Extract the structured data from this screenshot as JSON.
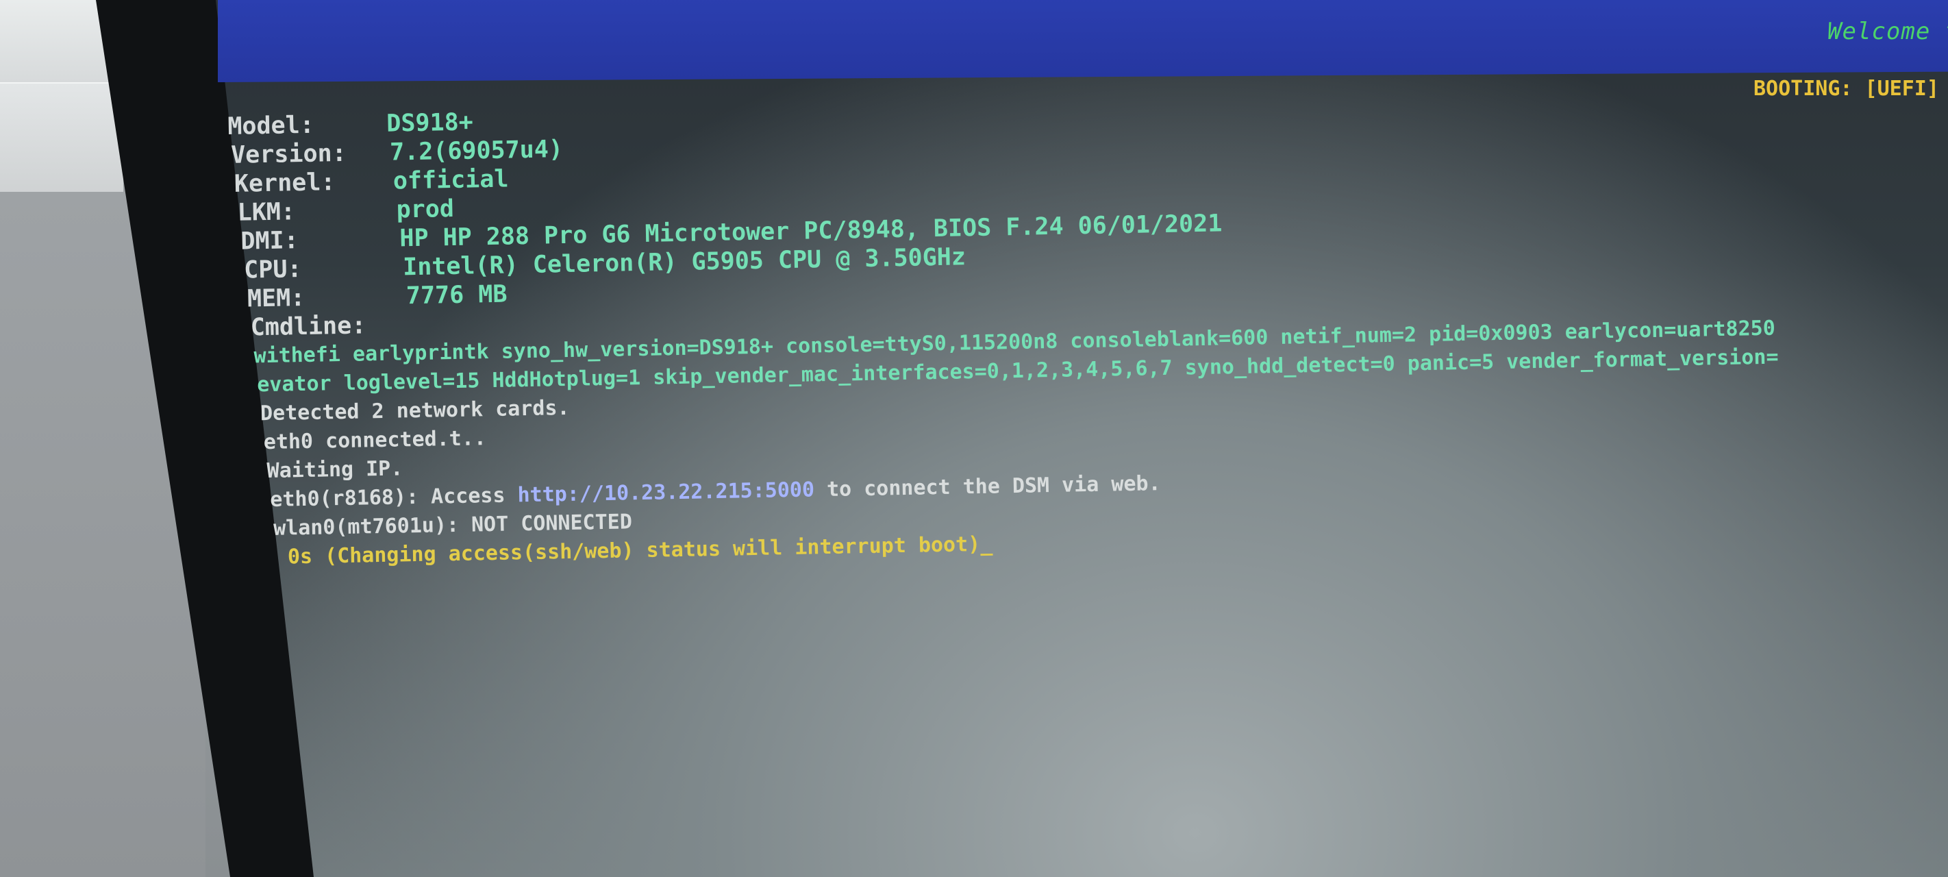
{
  "header": {
    "welcome": "Welcome t",
    "booting": "BOOTING: [UEFI]"
  },
  "system_info": [
    {
      "label": "Model:",
      "value": "DS918+"
    },
    {
      "label": "Version:",
      "value": "7.2(69057u4)"
    },
    {
      "label": "Kernel:",
      "value": "official"
    },
    {
      "label": "LKM:",
      "value": "prod"
    },
    {
      "label": "DMI:",
      "value": "HP HP 288 Pro G6 Microtower PC/8948, BIOS F.24 06/01/2021"
    },
    {
      "label": "CPU:",
      "value": "Intel(R) Celeron(R) G5905 CPU @ 3.50GHz"
    },
    {
      "label": "MEM:",
      "value": "7776 MB"
    }
  ],
  "cmdline": {
    "label": "Cmdline:",
    "line1": "withefi earlyprintk syno_hw_version=DS918+ console=ttyS0,115200n8 consoleblank=600 netif_num=2 pid=0x0903 earlycon=uart8250",
    "line2": "evator loglevel=15 HddHotplug=1 skip_vender_mac_interfaces=0,1,2,3,4,5,6,7 syno_hdd_detect=0 panic=5 vender_format_version="
  },
  "network": {
    "detected": "Detected 2 network cards.",
    "eth0_connected": "eth0 connected.t..",
    "waiting": "Waiting IP.",
    "eth0_prefix": "eth0(r8168): Access ",
    "eth0_url": "http://10.23.22.215:5000",
    "eth0_suffix": " to connect the DSM via web.",
    "wlan0": "wlan0(mt7601u): NOT CONNECTED"
  },
  "prompt": "0s (Changing access(ssh/web) status will interrupt boot)_",
  "colors": {
    "title_bar": "#2b3fb0",
    "welcome": "#4cd36a",
    "booting": "#e9c23a",
    "value_cyan": "#74e0b5",
    "link": "#a6b5ff",
    "prompt_yellow": "#e3cd49"
  }
}
